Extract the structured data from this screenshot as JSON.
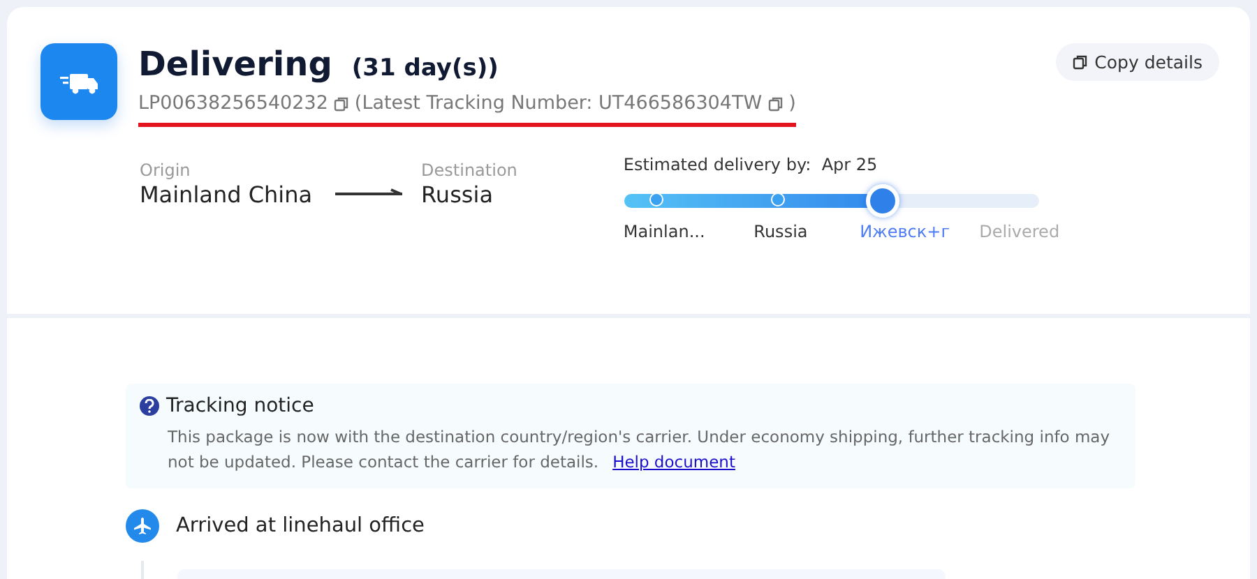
{
  "status": {
    "title": "Delivering",
    "duration": "(31 day(s))",
    "tracking_number": "LP00638256540232",
    "latest": "(Latest Tracking Number: UT466586304TW",
    "latest_close": ")"
  },
  "copy_button": {
    "label": "Copy details"
  },
  "route": {
    "origin_label": "Origin",
    "origin": "Mainland China",
    "destination_label": "Destination",
    "destination": "Russia"
  },
  "estimate": {
    "label": "Estimated delivery by:",
    "date": "Apr 25"
  },
  "progress": {
    "level": 0.62,
    "stops": [
      {
        "label": "Mainlan...",
        "reached": true,
        "current": false
      },
      {
        "label": "Russia",
        "reached": true,
        "current": false
      },
      {
        "label": "Ижевск+г",
        "reached": true,
        "current": true
      },
      {
        "label": "Delivered",
        "reached": false,
        "current": false
      }
    ]
  },
  "notice": {
    "title": "Tracking notice",
    "text": "This package is now with the destination country/region's carrier. Under economy shipping, further tracking info may not be updated. Please contact the carrier for details.",
    "link": "Help document"
  },
  "events": [
    {
      "title": "Arrived at linehaul office"
    }
  ]
}
